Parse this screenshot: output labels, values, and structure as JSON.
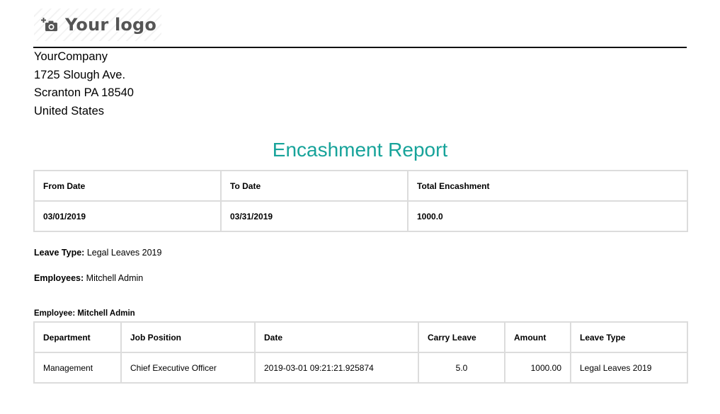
{
  "logo": {
    "text": "Your logo",
    "icon": "camera-plus-icon"
  },
  "company": {
    "name": "YourCompany",
    "street": "1725 Slough Ave.",
    "city_line": "Scranton PA 18540",
    "country": "United States"
  },
  "report": {
    "title": "Encashment Report",
    "title_color": "#17a39a"
  },
  "summary": {
    "headers": [
      "From Date",
      "To Date",
      "Total Encashment"
    ],
    "values": [
      "03/01/2019",
      "03/31/2019",
      "1000.0"
    ]
  },
  "info": {
    "leave_type_label": "Leave Type:",
    "leave_type_value": "Legal Leaves 2019",
    "employees_label": "Employees:",
    "employees_value": "Mitchell Admin"
  },
  "employee_section": {
    "heading": "Employee: Mitchell Admin",
    "headers": [
      "Department",
      "Job Position",
      "Date",
      "Carry Leave",
      "Amount",
      "Leave Type"
    ],
    "rows": [
      [
        "Management",
        "Chief Executive Officer",
        "2019-03-01 09:21:21.925874",
        "5.0",
        "1000.00",
        "Legal Leaves 2019"
      ]
    ]
  }
}
